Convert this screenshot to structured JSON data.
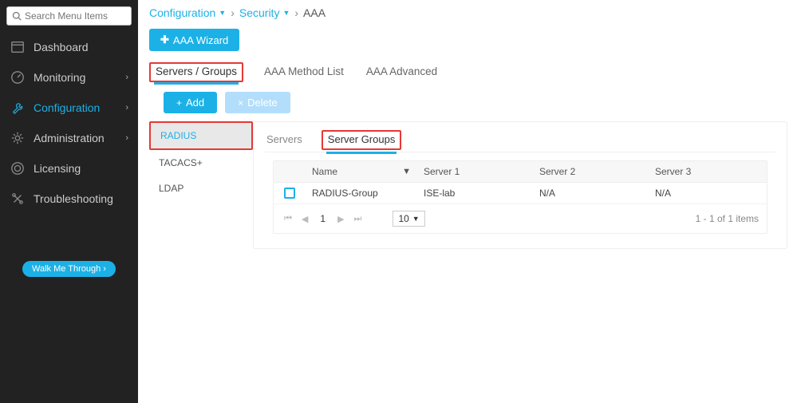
{
  "sidebar": {
    "search_placeholder": "Search Menu Items",
    "items": [
      {
        "label": "Dashboard",
        "expandable": false
      },
      {
        "label": "Monitoring",
        "expandable": true
      },
      {
        "label": "Configuration",
        "expandable": true,
        "active": true
      },
      {
        "label": "Administration",
        "expandable": true
      },
      {
        "label": "Licensing",
        "expandable": false
      },
      {
        "label": "Troubleshooting",
        "expandable": false
      }
    ],
    "walk_label": "Walk Me Through ›"
  },
  "breadcrumb": {
    "level1": "Configuration",
    "level2": "Security",
    "current": "AAA"
  },
  "wizard_label": "AAA Wizard",
  "tabs": {
    "servers_groups": "Servers / Groups",
    "method_list": "AAA Method List",
    "advanced": "AAA Advanced"
  },
  "actions": {
    "add": "Add",
    "delete": "Delete"
  },
  "protocols": {
    "radius": "RADIUS",
    "tacacs": "TACACS+",
    "ldap": "LDAP"
  },
  "subtabs": {
    "servers": "Servers",
    "server_groups": "Server Groups"
  },
  "table": {
    "headers": {
      "name": "Name",
      "s1": "Server 1",
      "s2": "Server 2",
      "s3": "Server 3"
    },
    "rows": [
      {
        "name": "RADIUS-Group",
        "s1": "ISE-lab",
        "s2": "N/A",
        "s3": "N/A"
      }
    ]
  },
  "pager": {
    "current": "1",
    "size": "10",
    "info": "1 - 1 of 1 items"
  }
}
